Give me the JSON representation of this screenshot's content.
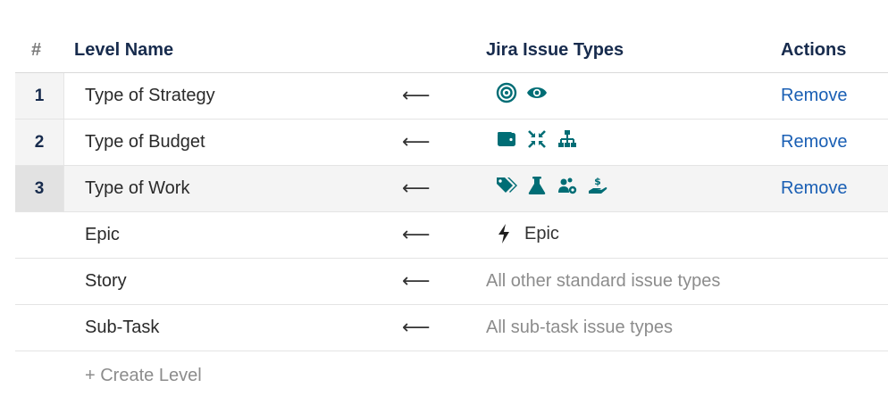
{
  "header": {
    "num": "#",
    "level_name": "Level Name",
    "issue_types": "Jira Issue Types",
    "actions": "Actions"
  },
  "levels": [
    {
      "num": "1",
      "name": "Type of Strategy",
      "arrow": "⟵",
      "icons": [
        "target-icon",
        "eye-icon"
      ],
      "action": "Remove"
    },
    {
      "num": "2",
      "name": "Type of Budget",
      "arrow": "⟵",
      "icons": [
        "wallet-icon",
        "compress-arrows-icon",
        "hierarchy-icon"
      ],
      "action": "Remove"
    },
    {
      "num": "3",
      "name": "Type of Work",
      "arrow": "⟵",
      "icons": [
        "tags-icon",
        "flask-icon",
        "users-cog-icon",
        "hand-holding-usd-icon"
      ],
      "action": "Remove"
    }
  ],
  "fixed_levels": [
    {
      "name": "Epic",
      "arrow": "⟵",
      "type_icon": "lightning-bolt-icon",
      "type_label": "Epic"
    },
    {
      "name": "Story",
      "arrow": "⟵",
      "type_text": "All other standard issue types"
    },
    {
      "name": "Sub-Task",
      "arrow": "⟵",
      "type_text": "All sub-task issue types"
    }
  ],
  "create_level": "+ Create Level",
  "colors": {
    "icon_teal": "#006d75",
    "link_blue": "#1a5fb4",
    "muted_text": "#8c8c8c",
    "selected_row": "#f4f4f4"
  }
}
